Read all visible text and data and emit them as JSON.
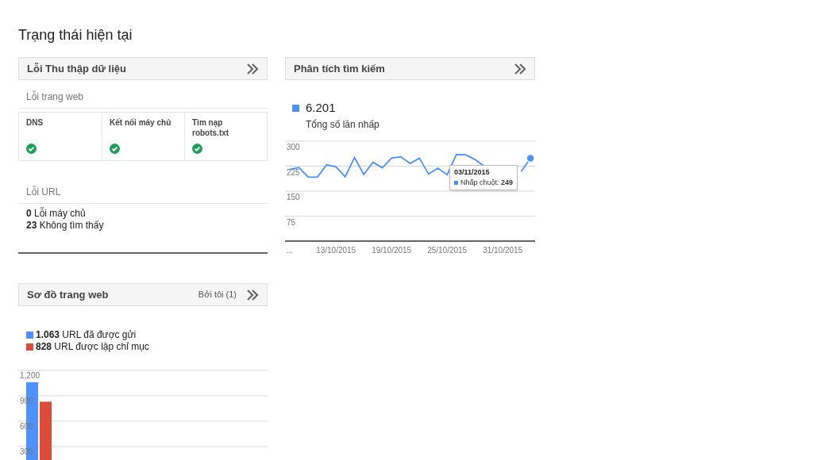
{
  "page_title": "Trạng thái hiện tại",
  "crawl_errors": {
    "title": "Lỗi Thu thập dữ liệu",
    "site_errors_heading": "Lỗi trang web",
    "checks": [
      {
        "label": "DNS",
        "ok": true
      },
      {
        "label": "Kết nối máy chủ",
        "ok": true
      },
      {
        "label": "Tìm nạp robots.txt",
        "ok": true
      }
    ],
    "url_errors_heading": "Lỗi URL",
    "url_errors": [
      "**0** Lỗi máy chủ",
      "**23** Không tìm thấy"
    ]
  },
  "search_analytics": {
    "title": "Phân tích tìm kiếm",
    "total": "6.201",
    "total_label": "Tổng số lần nhấp",
    "chart_data": {
      "type": "line",
      "categories": [
        "...",
        null,
        null,
        null,
        null,
        "13/10/2015",
        null,
        null,
        null,
        null,
        null,
        "19/10/2015",
        null,
        null,
        null,
        null,
        null,
        "25/10/2015",
        null,
        null,
        null,
        null,
        null,
        "31/10/2015",
        null,
        null,
        null
      ],
      "ylim": [
        0,
        300
      ],
      "yticks": [
        75,
        150,
        225,
        300
      ],
      "grid": true,
      "series": [
        {
          "color": "#4d90fe",
          "values": [
            215,
            221,
            192,
            192,
            229,
            223,
            193,
            251,
            200,
            237,
            220,
            249,
            253,
            233,
            249,
            201,
            219,
            199,
            260,
            259,
            245,
            225,
            null,
            null,
            null,
            209,
            249
          ]
        }
      ]
    },
    "tooltip": {
      "date": "03/11/2015",
      "text": "Nhấp chuột: **249**"
    }
  },
  "sitemaps": {
    "title": "Sơ đồ trang web",
    "filter_link": "Bởi tôi (1)",
    "legend": [
      {
        "text": "**1.063** URL đã được gửi",
        "color": "#4d90fe"
      },
      {
        "text": "**828** URL được lập chỉ mục",
        "color": "#dd4b39"
      }
    ],
    "chart_data": {
      "type": "bar",
      "categories": [
        null
      ],
      "ylim": [
        0,
        1200
      ],
      "grid": true,
      "yticks": [
        {
          "value": 300,
          "label": "300"
        },
        {
          "value": 600,
          "label": "600"
        },
        {
          "value": 900,
          "label": "900"
        },
        {
          "value": 1200,
          "label": "1,200"
        }
      ],
      "series": [
        {
          "color": "#4d90fe",
          "values": [
            1060
          ]
        },
        {
          "color": "#dd4b39",
          "values": [
            830
          ]
        }
      ]
    }
  }
}
